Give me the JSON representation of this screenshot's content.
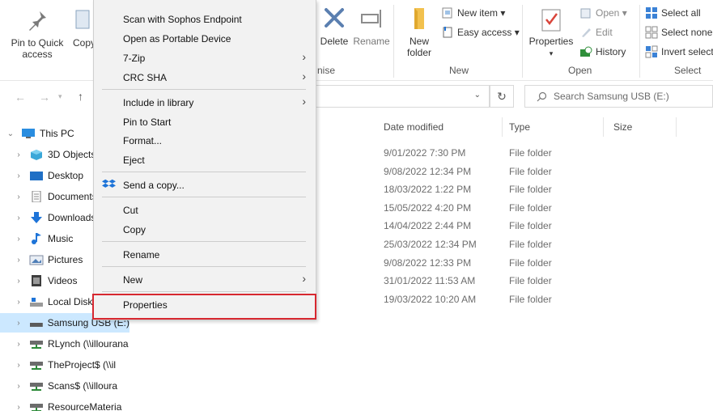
{
  "ribbon": {
    "pin_label_1": "Pin to Quick",
    "pin_label_2": "access",
    "copy_label": "Copy",
    "delete_label": "Delete",
    "rename_label": "Rename",
    "organise_partial": "nise",
    "new_folder_1": "New",
    "new_folder_2": "folder",
    "new_item": "New item ▾",
    "easy_access": "Easy access ▾",
    "new_group": "New",
    "properties_label": "Properties",
    "open_item": "Open ▾",
    "edit_item": "Edit",
    "history_item": "History",
    "open_group": "Open",
    "select_all": "Select all",
    "select_none": "Select none",
    "invert_select": "Invert select",
    "select_group": "Select"
  },
  "search": {
    "placeholder": "Search Samsung USB (E:)"
  },
  "columns": {
    "date": "Date modified",
    "type": "Type",
    "size": "Size"
  },
  "files": [
    {
      "date": "9/01/2022 7:30 PM",
      "type": "File folder"
    },
    {
      "date": "9/08/2022 12:34 PM",
      "type": "File folder"
    },
    {
      "date": "18/03/2022 1:22 PM",
      "type": "File folder"
    },
    {
      "date": "15/05/2022 4:20 PM",
      "type": "File folder"
    },
    {
      "date": "14/04/2022 2:44 PM",
      "type": "File folder"
    },
    {
      "date": "25/03/2022 12:34 PM",
      "type": "File folder"
    },
    {
      "date": "9/08/2022 12:33 PM",
      "type": "File folder"
    },
    {
      "date": "31/01/2022 11:53 AM",
      "type": "File folder"
    },
    {
      "date": "19/03/2022 10:20 AM",
      "type": "File folder"
    }
  ],
  "nav": [
    {
      "label": "This PC"
    },
    {
      "label": "3D Objects"
    },
    {
      "label": "Desktop"
    },
    {
      "label": "Documents"
    },
    {
      "label": "Downloads"
    },
    {
      "label": "Music"
    },
    {
      "label": "Pictures"
    },
    {
      "label": "Videos"
    },
    {
      "label": "Local Disk"
    },
    {
      "label": "Samsung USB (E:)"
    },
    {
      "label": "RLynch (\\\\illourana"
    },
    {
      "label": "TheProject$ (\\\\il"
    },
    {
      "label": "Scans$ (\\\\illoura"
    },
    {
      "label": "ResourceMateria"
    }
  ],
  "menu": {
    "scan": "Scan with Sophos Endpoint",
    "open_portable": "Open as Portable Device",
    "zip": "7-Zip",
    "crc": "CRC SHA",
    "include": "Include in library",
    "pin_start": "Pin to Start",
    "format": "Format...",
    "eject": "Eject",
    "send_copy": "Send a copy...",
    "cut": "Cut",
    "copy": "Copy",
    "rename": "Rename",
    "new": "New",
    "properties": "Properties"
  },
  "colors": {
    "highlight": "#d72830",
    "selection": "#cce8ff",
    "accent": "#1e74d8"
  }
}
